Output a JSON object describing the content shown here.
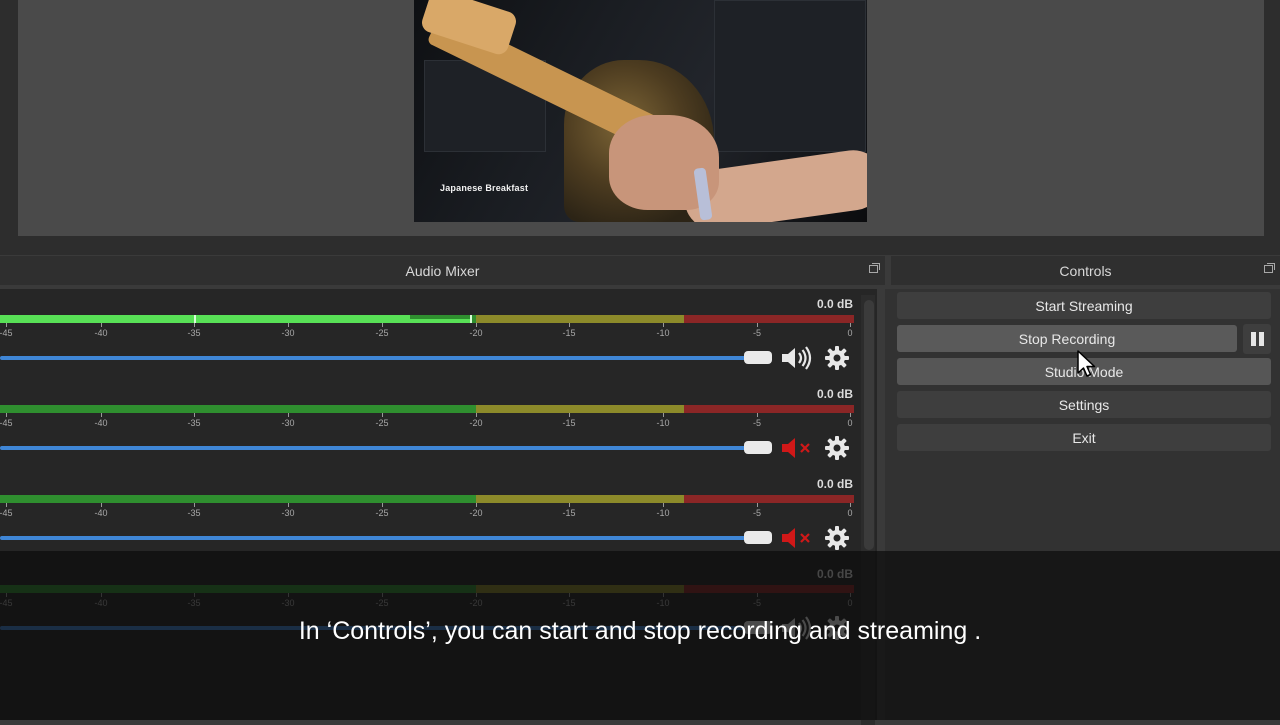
{
  "preview": {
    "video_caption": "Japanese Breakfast"
  },
  "audio_mixer": {
    "title": "Audio Mixer",
    "tick_labels": [
      "-45",
      "-40",
      "-35",
      "-30",
      "-25",
      "-20",
      "-15",
      "-10",
      "-5",
      "0"
    ],
    "channels": [
      {
        "level_label": "0.0 dB",
        "muted": false
      },
      {
        "level_label": "0.0 dB",
        "muted": true
      },
      {
        "level_label": "0.0 dB",
        "muted": true
      },
      {
        "level_label": "0.0 dB",
        "muted": false
      }
    ],
    "colors": {
      "green": "#2f8f2f",
      "yellow": "#8c8a2a",
      "red": "#8b2626",
      "slider": "#3f86d6",
      "mute": "#d01818"
    }
  },
  "controls": {
    "title": "Controls",
    "start_streaming": "Start Streaming",
    "stop_recording": "Stop Recording",
    "studio_mode": "Studio Mode",
    "settings": "Settings",
    "exit": "Exit"
  },
  "subtitle": "In ‘Controls’, you can start and stop recording and streaming ."
}
